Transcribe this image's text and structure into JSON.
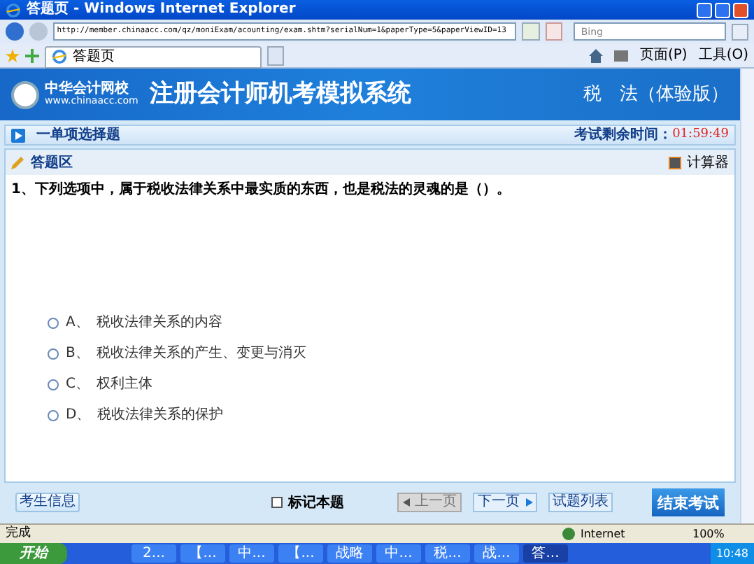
{
  "window": {
    "title": "答题页 - Windows Internet Explorer"
  },
  "address_bar": {
    "value": "http://member.chinaacc.com/qz/moniExam/acounting/exam.shtm?serialNum=1&paperType=5&paperViewID=13"
  },
  "search": {
    "placeholder": "Bing"
  },
  "tabs": [
    {
      "label": "答题页",
      "selected": true
    }
  ],
  "toolbar": {
    "page": "页面(P)",
    "tools": "工具(O)"
  },
  "banner": {
    "logo_name": "中华会计网校",
    "logo_url": "www.chinaacc.com",
    "title": "注册会计师机考模拟系统",
    "subject": "税　法（体验版）"
  },
  "section": {
    "title": "一单项选择题",
    "timer_label": "考试剩余时间：",
    "timer": "01:59:49"
  },
  "answer_area": {
    "title": "答题区",
    "calculator": "计算器"
  },
  "question": {
    "text": "1、下列选项中，属于税收法律关系中最实质的东西，也是税法的灵魂的是（）。",
    "options": [
      {
        "letter": "A、",
        "text": "税收法律关系的内容",
        "selected": false
      },
      {
        "letter": "B、",
        "text": "税收法律关系的产生、变更与消灭",
        "selected": false
      },
      {
        "letter": "C、",
        "text": "权利主体",
        "selected": false
      },
      {
        "letter": "D、",
        "text": "税收法律关系的保护",
        "selected": false
      }
    ]
  },
  "footer": {
    "student_info": "考生信息",
    "mark": {
      "label": "标记本题",
      "checked": false
    },
    "prev": {
      "label": "上一页",
      "disabled": true
    },
    "next": {
      "label": "下一页",
      "disabled": false
    },
    "list": "试题列表",
    "finish": "结束考试"
  },
  "status_bar": {
    "status": "完成",
    "zone": "Internet",
    "zoom": "100%"
  },
  "taskbar": {
    "start": "开始",
    "items": [
      {
        "label": "2...",
        "selected": false
      },
      {
        "label": "【...",
        "selected": false
      },
      {
        "label": "中...",
        "selected": false
      },
      {
        "label": "【...",
        "selected": false
      },
      {
        "label": "战略",
        "selected": false
      },
      {
        "label": "中...",
        "selected": false
      },
      {
        "label": "税...",
        "selected": false
      },
      {
        "label": "战...",
        "selected": false
      },
      {
        "label": "答...",
        "selected": true
      }
    ],
    "clock": "10:48"
  }
}
